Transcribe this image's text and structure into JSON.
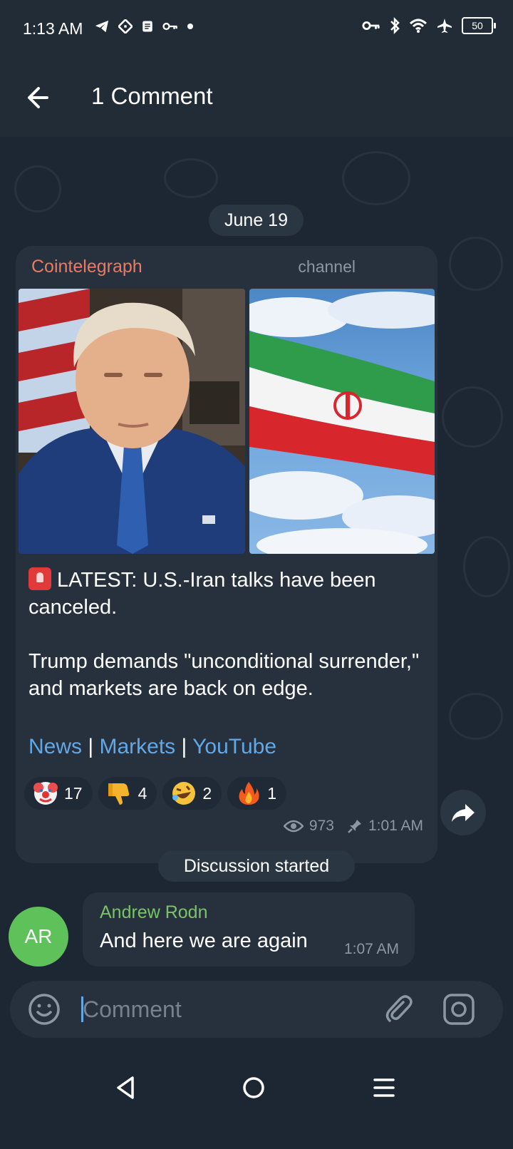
{
  "status_bar": {
    "time": "1:13 AM",
    "left_icons": [
      "telegram-icon",
      "app-icon",
      "note-icon",
      "key-icon",
      "dot-icon"
    ],
    "right_icons": [
      "vpn-key-icon",
      "bluetooth-icon",
      "wifi-icon",
      "airplane-icon"
    ],
    "battery": "50"
  },
  "header": {
    "back_icon": "arrow-left-icon",
    "title": "1 Comment"
  },
  "date_separator": "June 19",
  "post": {
    "channel_name": "Cointelegraph",
    "channel_tag": "channel",
    "text_line1": "LATEST: U.S.-Iran talks have been canceled.",
    "text_line2": "Trump demands \"unconditional surrender,\" and markets are back on edge.",
    "links": [
      "News",
      "Markets",
      "YouTube"
    ],
    "link_separator": "|",
    "reactions": [
      {
        "emoji": "🤡",
        "count": "17"
      },
      {
        "emoji": "👎",
        "count": "4"
      },
      {
        "emoji": "🤣",
        "count": "2"
      },
      {
        "emoji": "🔥",
        "count": "1"
      }
    ],
    "views": "973",
    "time": "1:01 AM",
    "colors": {
      "channel": "#ec7a63",
      "link": "#62a8e6"
    }
  },
  "system_message": "Discussion started",
  "comment": {
    "avatar_initials": "AR",
    "author": "Andrew Rodn",
    "text": "And here we are again",
    "time": "1:07 AM",
    "colors": {
      "avatar": "#5ec159",
      "author": "#78c466"
    }
  },
  "input": {
    "placeholder": "Comment"
  },
  "nav": {
    "icons": [
      "nav-back-icon",
      "nav-home-icon",
      "nav-menu-icon"
    ]
  }
}
